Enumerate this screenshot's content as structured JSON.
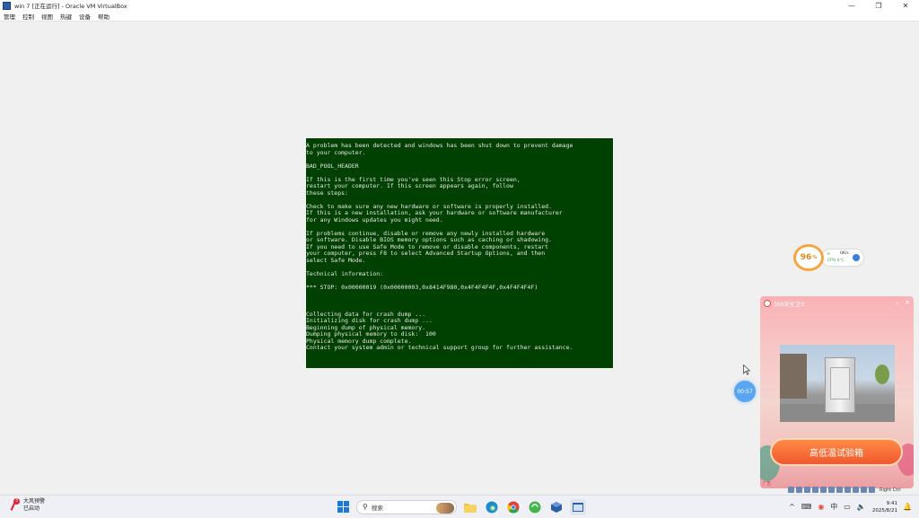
{
  "window": {
    "title": "win 7 [正在运行] - Oracle VM VirtualBox",
    "controls": {
      "minimize": "—",
      "maximize": "❐",
      "close": "✕"
    }
  },
  "menu": [
    "管理",
    "控制",
    "视图",
    "热键",
    "设备",
    "帮助"
  ],
  "bsod": {
    "lines": [
      "A problem has been detected and windows has been shut down to prevent damage",
      "to your computer.",
      "",
      "BAD_POOL_HEADER",
      "",
      "If this is the first time you've seen this Stop error screen,",
      "restart your computer. If this screen appears again, follow",
      "these steps:",
      "",
      "Check to make sure any new hardware or software is properly installed.",
      "If this is a new installation, ask your hardware or software manufacturer",
      "for any Windows updates you might need.",
      "",
      "If problems continue, disable or remove any newly installed hardware",
      "or software. Disable BIOS memory options such as caching or shadowing.",
      "If you need to use Safe Mode to remove or disable components, restart",
      "your computer, press F8 to select Advanced Startup Options, and then",
      "select Safe Mode.",
      "",
      "Technical information:",
      "",
      "*** STOP: 0x00000019 (0x00000003,0x8414F980,0x4F4F4F4F,0x4F4F4F4F)",
      "",
      "",
      "",
      "Collecting data for crash dump ...",
      "Initializing disk for crash dump ...",
      "Beginning dump of physical memory.",
      "Dumping physical memory to disk:  100",
      "Physical memory dump complete.",
      "Contact your system admin or technical support group for further assistance."
    ]
  },
  "widget360": {
    "percent": "96",
    "percent_unit": "%",
    "net_speed": "0K/s",
    "cpu_label": "CPU 0℃",
    "plus": "+"
  },
  "timer_bubble": "00:57",
  "popup": {
    "title": "360安全卫士",
    "collapse": "⌄",
    "close": "✕",
    "cta": "高低温试验箱",
    "ad_tag": "广告"
  },
  "vm_status": {
    "host_key": "Right Ctrl"
  },
  "taskbar": {
    "weather_badge": "3",
    "weather_title": "大风预警",
    "weather_sub": "已启动",
    "search_placeholder": "搜索",
    "clock_time": "9:41",
    "clock_date": "2025/8/21"
  },
  "colors": {
    "bsod_bg": "#004000",
    "accent": "#1a78d8",
    "cta": "#f2582e"
  }
}
